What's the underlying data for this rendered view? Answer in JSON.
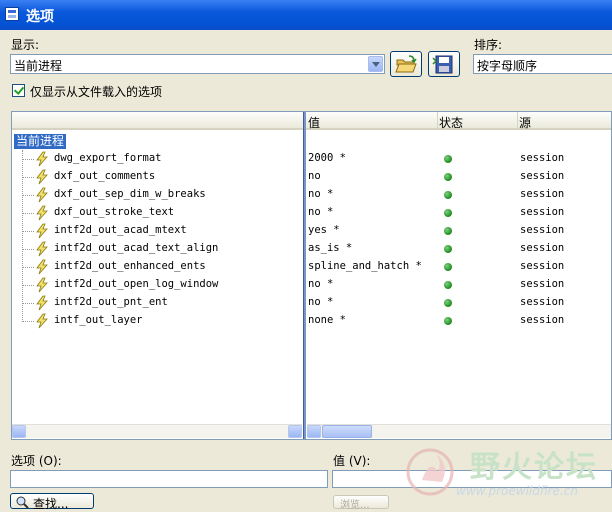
{
  "window": {
    "title": "选项"
  },
  "display": {
    "label": "显示:",
    "value": "当前进程"
  },
  "sort": {
    "label": "排序:",
    "value": "按字母顺序"
  },
  "filter": {
    "label": "仅显示从文件载入的选项",
    "checked": true
  },
  "columns": {
    "value": "值",
    "status": "状态",
    "source": "源"
  },
  "tree": {
    "root": "当前进程",
    "items": [
      {
        "name": "dwg_export_format",
        "value": "2000 *",
        "status": "green",
        "source": "session"
      },
      {
        "name": "dxf_out_comments",
        "value": "no",
        "status": "green",
        "source": "session"
      },
      {
        "name": "dxf_out_sep_dim_w_breaks",
        "value": "no *",
        "status": "green",
        "source": "session"
      },
      {
        "name": "dxf_out_stroke_text",
        "value": "no *",
        "status": "green",
        "source": "session"
      },
      {
        "name": "intf2d_out_acad_mtext",
        "value": "yes *",
        "status": "green",
        "source": "session"
      },
      {
        "name": "intf2d_out_acad_text_align",
        "value": "as_is *",
        "status": "green",
        "source": "session"
      },
      {
        "name": "intf2d_out_enhanced_ents",
        "value": "spline_and_hatch *",
        "status": "green",
        "source": "session"
      },
      {
        "name": "intf2d_out_open_log_window",
        "value": "no *",
        "status": "green",
        "source": "session"
      },
      {
        "name": "intf2d_out_pnt_ent",
        "value": "no *",
        "status": "green",
        "source": "session"
      },
      {
        "name": "intf_out_layer",
        "value": "none *",
        "status": "green",
        "source": "session"
      }
    ]
  },
  "bottom": {
    "option_label": "选项 (O):",
    "value_label": "值 (V):",
    "option_value": "",
    "value_value": "",
    "find_button": "查找...",
    "browse_button": "浏览..."
  },
  "watermark": {
    "text": "野火论坛",
    "url": "www.proewildfire.cn"
  },
  "colors": {
    "title_bar": "#0a58dc",
    "selection": "#316ac5",
    "status_dot": "#1f8a1f"
  }
}
